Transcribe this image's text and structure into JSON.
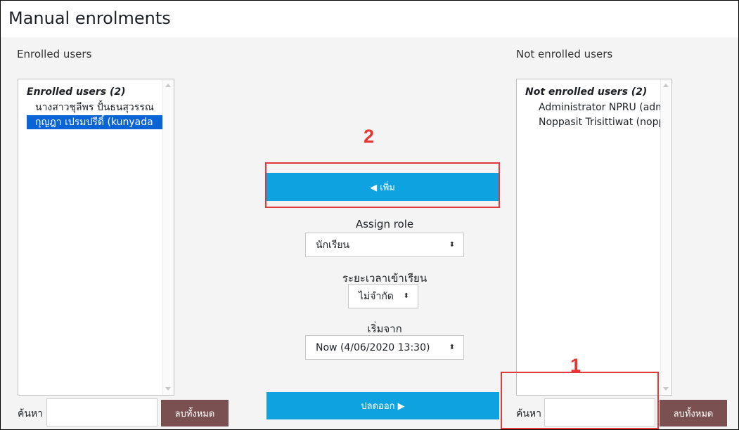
{
  "page": {
    "title": "Manual enrolments"
  },
  "enrolled": {
    "heading": "Enrolled users",
    "group_label": "Enrolled users (2)",
    "options": [
      {
        "label": "นางสาวชุลีพร ปั้นธนสุวรรณ",
        "selected": false
      },
      {
        "label": "กุญฎา เปรมปรีดิ์ (kunyada",
        "selected": true
      }
    ],
    "search_label": "ค้นหา",
    "search_value": "",
    "clear_label": "ลบทั้งหมด"
  },
  "not_enrolled": {
    "heading": "Not enrolled users",
    "group_label": "Not enrolled users (2)",
    "options": [
      {
        "label": "Administrator NPRU (admin",
        "selected": false
      },
      {
        "label": "Noppasit Trisittiwat (noppasit",
        "selected": false
      }
    ],
    "search_label": "ค้นหา",
    "search_value": "",
    "clear_label": "ลบทั้งหมด"
  },
  "controls": {
    "add_label": "◀ เพิ่ม",
    "remove_label": "ปลดออก ▶",
    "assign_role_label": "Assign role",
    "assign_role_value": "นักเรียน",
    "duration_label": "ระยะเวลาเข้าเรียน",
    "duration_value": "ไม่จำกัด",
    "start_label": "เริ่มจาก",
    "start_value": "Now (4/06/2020 13:30)"
  },
  "callouts": {
    "step1": "1",
    "step2": "2"
  },
  "colors": {
    "primary": "#0fa2e0",
    "selected": "#0a64d6",
    "danger_btn": "#7a5150",
    "highlight": "#e03a3a"
  },
  "icons": {
    "select_caret": "⬍"
  }
}
